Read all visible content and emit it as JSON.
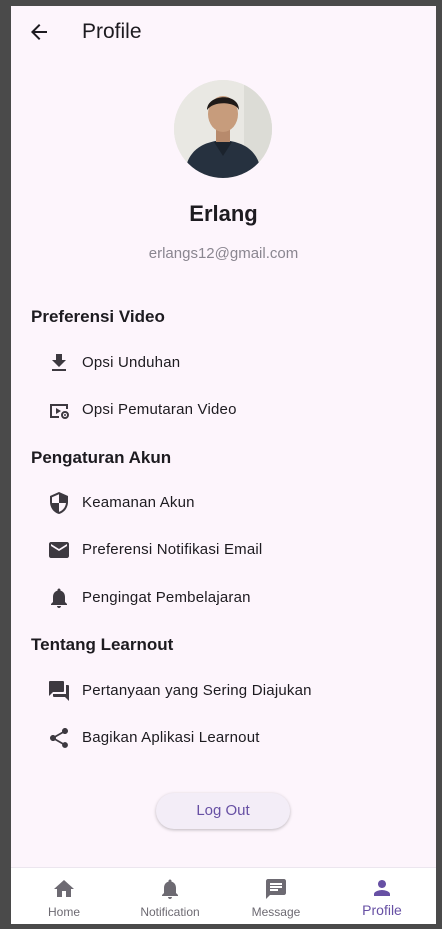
{
  "app": {
    "title": "Profile",
    "accent": "#6750a4",
    "background": "#fdf5fc"
  },
  "profile": {
    "name": "Erlang",
    "email": "erlangs12@gmail.com"
  },
  "sections": [
    {
      "title": "Preferensi Video",
      "items": [
        {
          "label": "Opsi Unduhan",
          "icon": "download-icon"
        },
        {
          "label": "Opsi Pemutaran Video",
          "icon": "video-settings-icon"
        }
      ]
    },
    {
      "title": "Pengaturan Akun",
      "items": [
        {
          "label": "Keamanan Akun",
          "icon": "shield-icon"
        },
        {
          "label": "Preferensi Notifikasi Email",
          "icon": "mail-icon"
        },
        {
          "label": "Pengingat Pembelajaran",
          "icon": "bell-icon"
        }
      ]
    },
    {
      "title": "Tentang Learnout",
      "items": [
        {
          "label": "Pertanyaan yang Sering Diajukan",
          "icon": "forum-icon"
        },
        {
          "label": "Bagikan Aplikasi Learnout",
          "icon": "share-icon"
        }
      ]
    }
  ],
  "logout_label": "Log Out",
  "nav": [
    {
      "label": "Home",
      "icon": "home-icon",
      "active": false
    },
    {
      "label": "Notification",
      "icon": "bell-icon",
      "active": false
    },
    {
      "label": "Message",
      "icon": "message-icon",
      "active": false
    },
    {
      "label": "Profile",
      "icon": "person-icon",
      "active": true
    }
  ]
}
